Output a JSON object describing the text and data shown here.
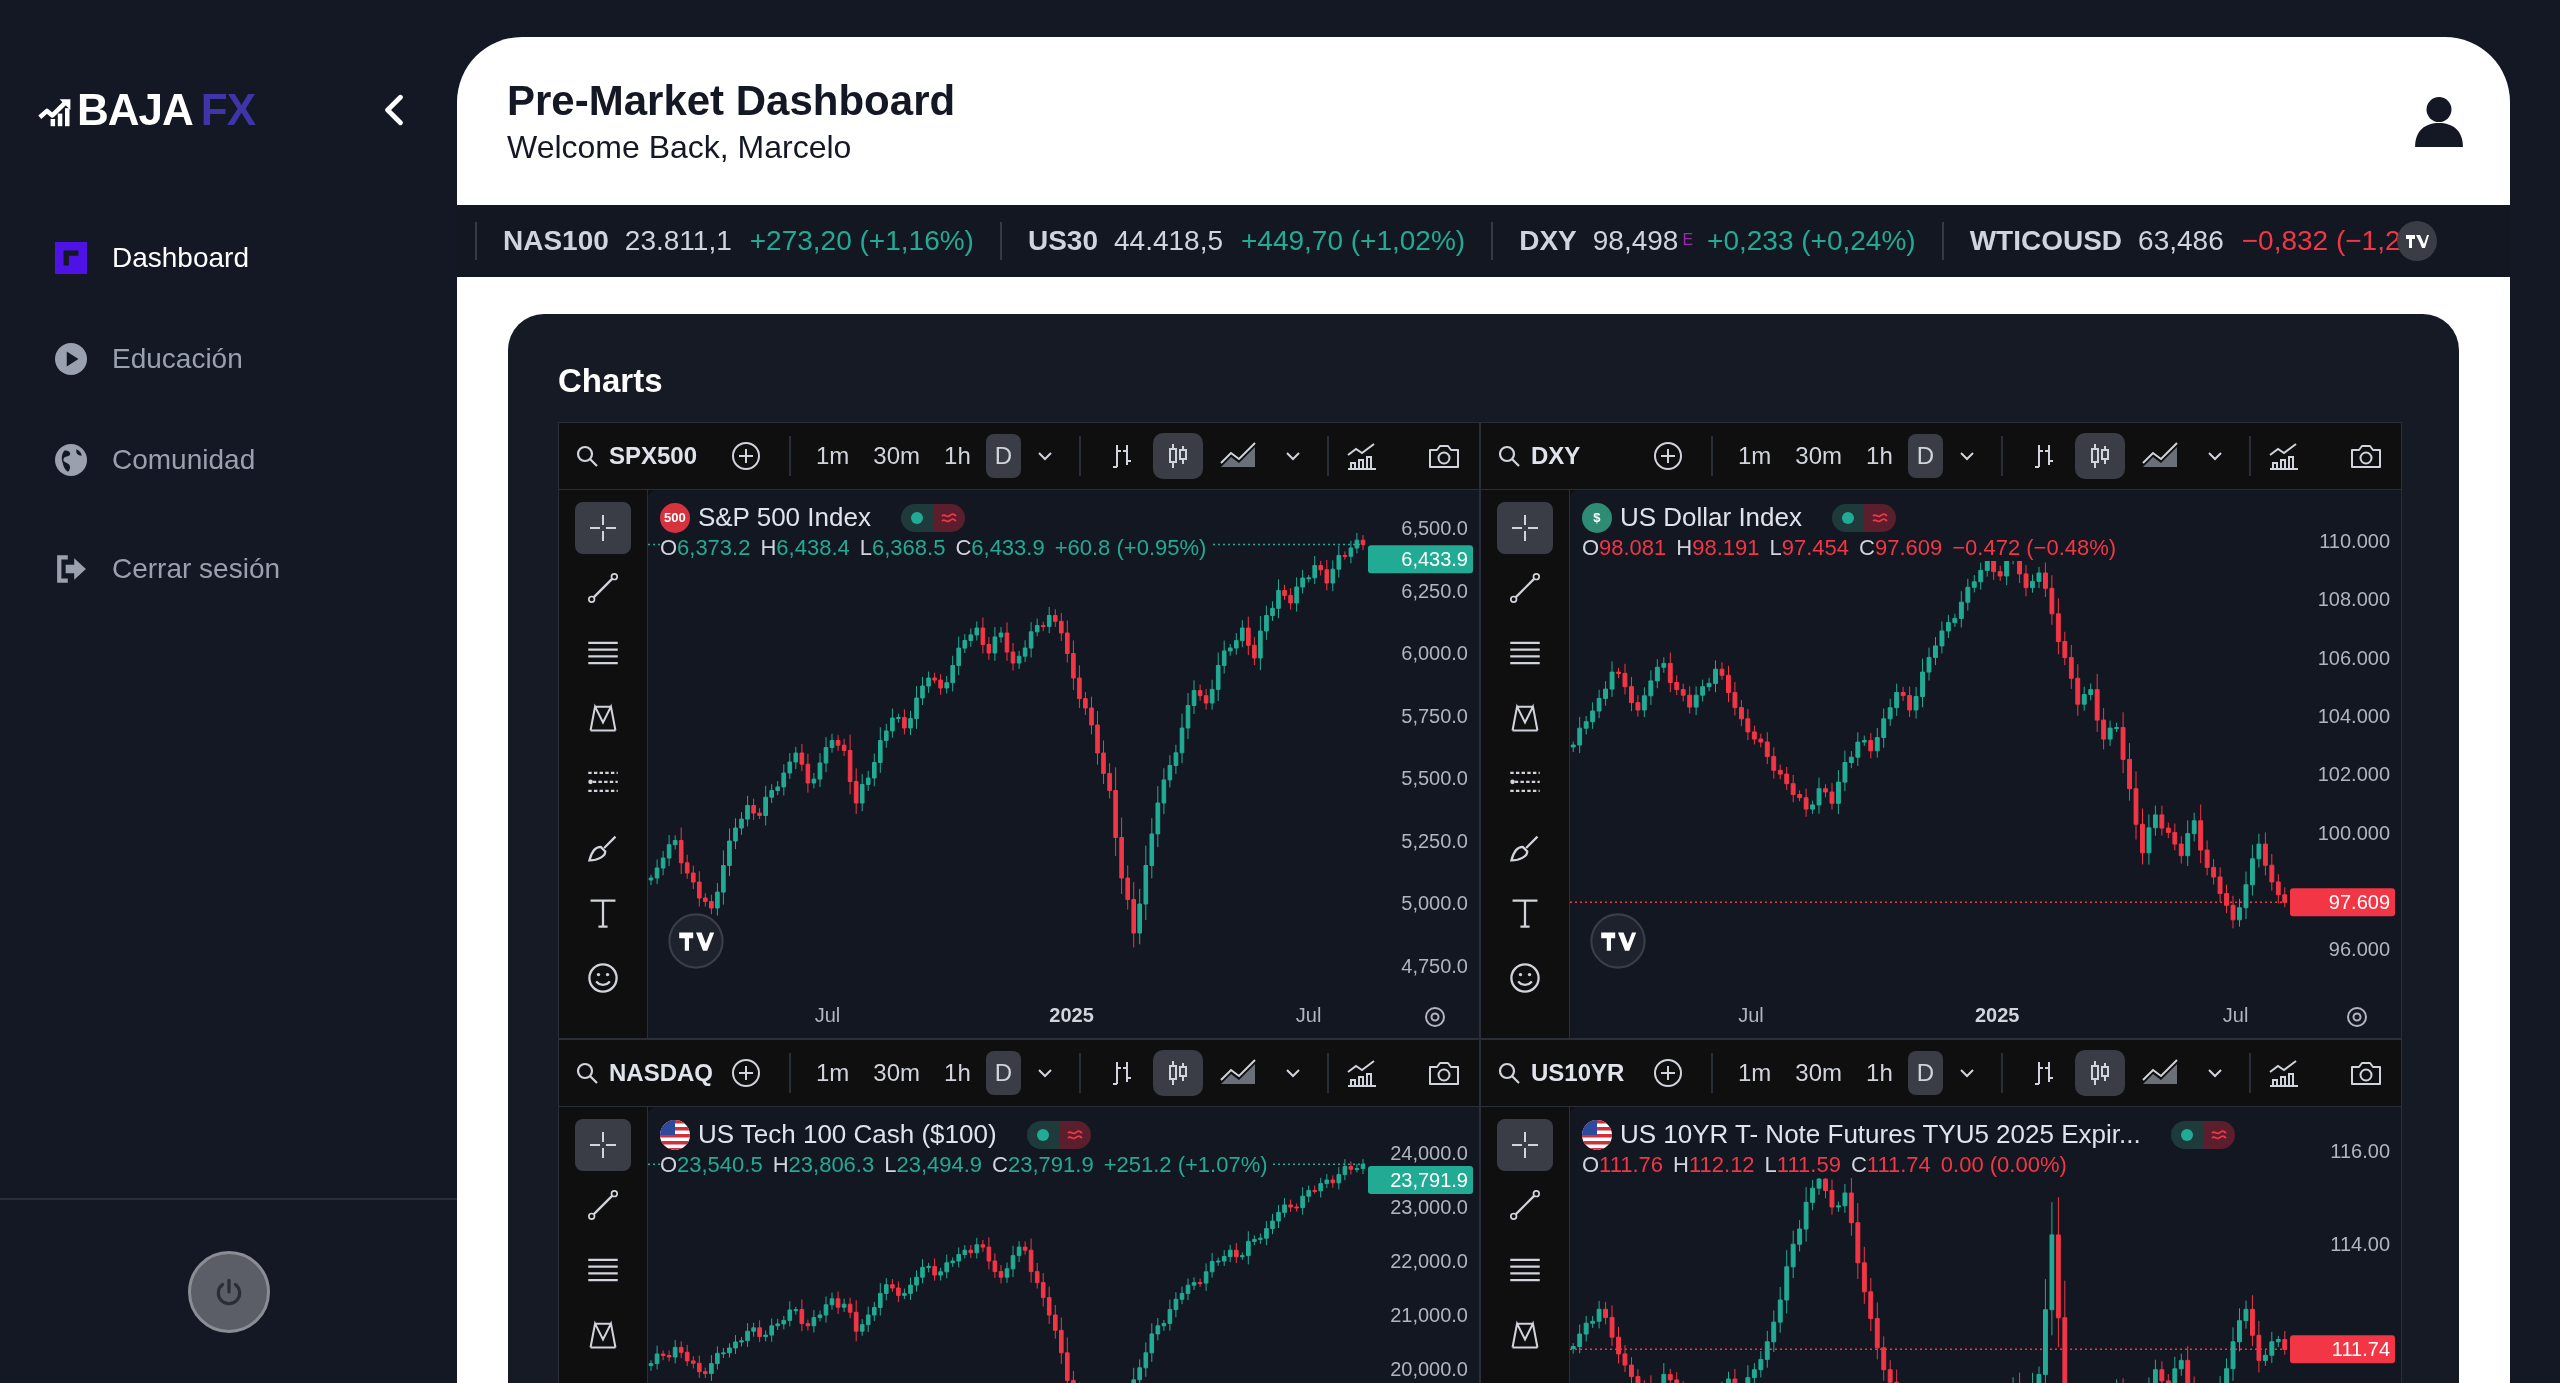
{
  "sidebar": {
    "logo": {
      "text": "BAJA",
      "accent": "FX"
    },
    "nav": [
      {
        "label": "Dashboard",
        "selected": true
      },
      {
        "label": "Educación",
        "selected": false
      },
      {
        "label": "Comunidad",
        "selected": false
      },
      {
        "label": "Cerrar sesión",
        "selected": false
      }
    ]
  },
  "header": {
    "title": "Pre-Market Dashboard",
    "subtitle": "Welcome Back, Marcelo"
  },
  "ticker": [
    {
      "symbol": "NAS100",
      "price": "23.811,1",
      "change": "+273,20 (+1,16%)",
      "color": "#22ab94"
    },
    {
      "symbol": "US30",
      "price": "44.418,5",
      "change": "+449,70 (+1,02%)",
      "color": "#22ab94"
    },
    {
      "symbol": "DXY",
      "price": "98,498",
      "flag": "E",
      "change": "+0,233 (+0,24%)",
      "color": "#22ab94"
    },
    {
      "symbol": "WTICOUSD",
      "price": "63,486",
      "change": "−0,832 (−1,2",
      "color": "#f23645"
    }
  ],
  "charts_section": {
    "title": "Charts",
    "widgets": [
      {
        "symbol": "SPX500",
        "timeframes": [
          {
            "label": "1m",
            "selected": false
          },
          {
            "label": "30m",
            "selected": false
          },
          {
            "label": "1h",
            "selected": false
          },
          {
            "label": "D",
            "selected": true
          }
        ],
        "chart_types": [
          {
            "kind": "bars",
            "selected": false
          },
          {
            "kind": "candles",
            "selected": true
          },
          {
            "kind": "area",
            "selected": false
          }
        ],
        "badge": {
          "kind": "text",
          "text": "500",
          "color": "#d6333f"
        },
        "name": "S&P 500 Index",
        "color": "#22ab94",
        "ohlc": [
          {
            "label": "O",
            "value": "6,373.2"
          },
          {
            "label": "H",
            "value": "6,438.4"
          },
          {
            "label": "L",
            "value": "6,368.5"
          },
          {
            "label": "C",
            "value": "6,433.9"
          }
        ],
        "change": "+60.8 (+0.95%)",
        "price_label": "6,433.9",
        "price_axis": [
          "6,500.0",
          "6,250.0",
          "6,000.0",
          "5,750.0",
          "5,500.0",
          "5,250.0",
          "5,000.0",
          "4,750.0"
        ],
        "time_axis": [
          "Jul",
          "2025",
          "Jul"
        ]
      },
      {
        "symbol": "DXY",
        "timeframes": [
          {
            "label": "1m",
            "selected": false
          },
          {
            "label": "30m",
            "selected": false
          },
          {
            "label": "1h",
            "selected": false
          },
          {
            "label": "D",
            "selected": true
          }
        ],
        "chart_types": [
          {
            "kind": "bars",
            "selected": false
          },
          {
            "kind": "candles",
            "selected": true
          },
          {
            "kind": "area",
            "selected": false
          }
        ],
        "badge": {
          "kind": "text",
          "text": "$",
          "color": "#2e8b74"
        },
        "name": "US Dollar Index",
        "color": "#f23645",
        "ohlc": [
          {
            "label": "O",
            "value": "98.081"
          },
          {
            "label": "H",
            "value": "98.191"
          },
          {
            "label": "L",
            "value": "97.454"
          },
          {
            "label": "C",
            "value": "97.609"
          }
        ],
        "change": "−0.472 (−0.48%)",
        "price_label": "97.609",
        "price_axis": [
          "110.000",
          "108.000",
          "106.000",
          "104.000",
          "102.000",
          "100.000",
          "96.000"
        ],
        "time_axis": [
          "Jul",
          "2025",
          "Jul"
        ]
      },
      {
        "symbol": "NASDAQ",
        "timeframes": [
          {
            "label": "1m",
            "selected": false
          },
          {
            "label": "30m",
            "selected": false
          },
          {
            "label": "1h",
            "selected": false
          },
          {
            "label": "D",
            "selected": true
          }
        ],
        "chart_types": [
          {
            "kind": "bars",
            "selected": false
          },
          {
            "kind": "candles",
            "selected": true
          },
          {
            "kind": "area",
            "selected": false
          }
        ],
        "badge": {
          "kind": "flag"
        },
        "name": "US Tech 100 Cash ($100)",
        "color": "#22ab94",
        "ohlc": [
          {
            "label": "O",
            "value": "23,540.5"
          },
          {
            "label": "H",
            "value": "23,806.3"
          },
          {
            "label": "L",
            "value": "23,494.9"
          },
          {
            "label": "C",
            "value": "23,791.9"
          }
        ],
        "change": "+251.2 (+1.07%)",
        "price_label": "23,791.9",
        "price_axis": [
          "24,000.0",
          "23,000.0",
          "22,000.0",
          "21,000.0",
          "20,000.0"
        ]
      },
      {
        "symbol": "US10YR",
        "timeframes": [
          {
            "label": "1m",
            "selected": false
          },
          {
            "label": "30m",
            "selected": false
          },
          {
            "label": "1h",
            "selected": false
          },
          {
            "label": "D",
            "selected": true
          }
        ],
        "chart_types": [
          {
            "kind": "bars",
            "selected": false
          },
          {
            "kind": "candles",
            "selected": true
          },
          {
            "kind": "area",
            "selected": false
          }
        ],
        "badge": {
          "kind": "flag"
        },
        "name": "US 10YR T- Note Futures TYU5 2025 Expir...",
        "color": "#f23645",
        "ohlc": [
          {
            "label": "O",
            "value": "111.76"
          },
          {
            "label": "H",
            "value": "112.12"
          },
          {
            "label": "L",
            "value": "111.59"
          },
          {
            "label": "C",
            "value": "111.74"
          }
        ],
        "change": "0.00 (0.00%)",
        "price_label": "111.74",
        "price_axis": [
          "116.00",
          "114.00"
        ]
      }
    ]
  }
}
